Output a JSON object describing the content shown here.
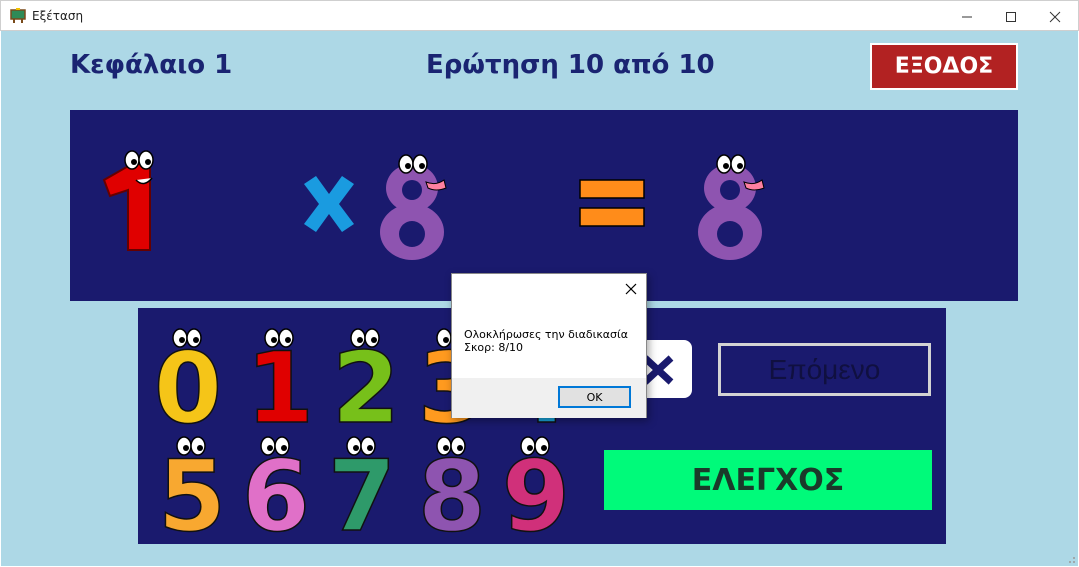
{
  "window": {
    "title": "Εξέταση",
    "icon": "blackboard-icon"
  },
  "header": {
    "chapter": "Κεφάλαιο 1",
    "question_counter": "Ερώτηση 10 από 10",
    "exit_label": "ΕΞΟΔΟΣ"
  },
  "equation": {
    "left_operand": "1",
    "operator": "×",
    "right_operand": "8",
    "equals": "=",
    "result": "8"
  },
  "digit_palette": [
    "0",
    "1",
    "2",
    "3",
    "4",
    "5",
    "6",
    "7",
    "8",
    "9"
  ],
  "controls": {
    "answer_mark": "✕",
    "next_label": "Επόμενο",
    "check_label": "ΕΛΕΓΧΟΣ"
  },
  "dialog": {
    "message_line1": "Ολοκλήρωσες την διαδικασία",
    "message_line2": "Σκορ: 8/10",
    "ok_label": "OK"
  },
  "colors": {
    "background": "#add8e6",
    "panel": "#1a1a6e",
    "heading": "#1a2472",
    "exit": "#b22222",
    "check": "#00fa7a",
    "digit_0": "#f5c518",
    "digit_1": "#e00000",
    "digit_2": "#77c01a",
    "digit_3": "#ff9a1f",
    "digit_4": "#1aa3d9",
    "digit_5": "#f8a830",
    "digit_6": "#e070c8",
    "digit_7": "#2e9a6a",
    "digit_8": "#8e54b0",
    "digit_9": "#d0307a",
    "operator_x": "#1a9be0",
    "operator_eq": "#ff8c1a"
  }
}
